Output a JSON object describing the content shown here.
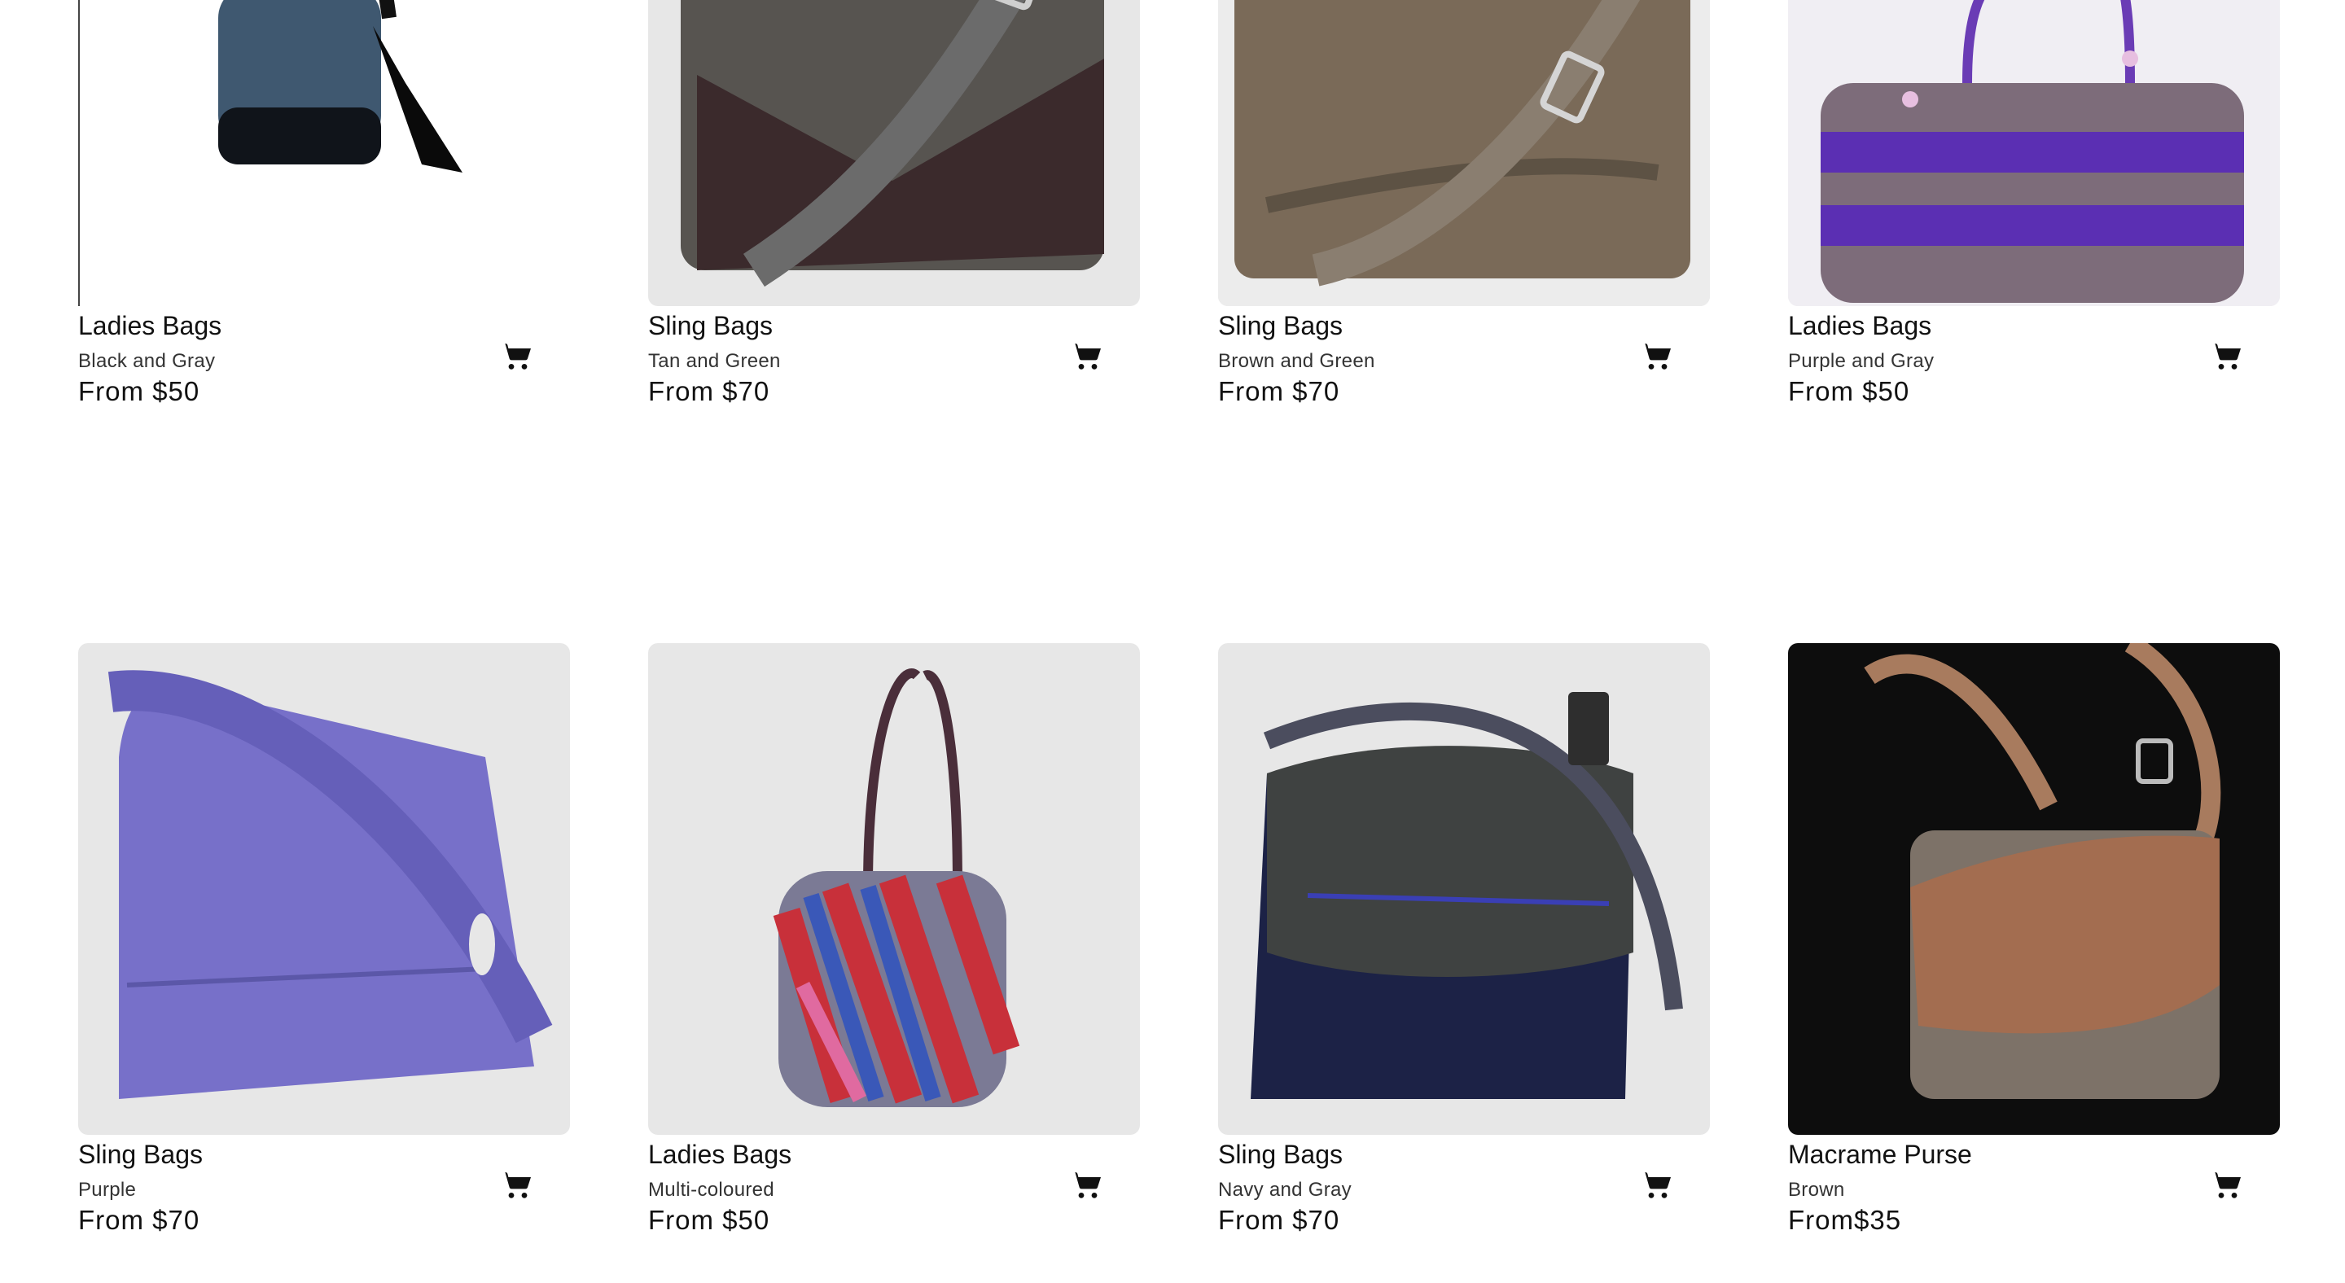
{
  "products": [
    {
      "title": "Ladies Bags",
      "variant": "Black and Gray",
      "price": "From $50",
      "image": "black-gray-bucket-bag"
    },
    {
      "title": "Sling Bags",
      "variant": "Tan and Green",
      "price": "From $70",
      "image": "tan-green-sling-bag"
    },
    {
      "title": "Sling Bags",
      "variant": "Brown and Green",
      "price": "From $70",
      "image": "brown-green-sling-bag"
    },
    {
      "title": "Ladies Bags",
      "variant": "Purple and Gray",
      "price": "From $50",
      "image": "purple-gray-tote-bag"
    },
    {
      "title": "Sling Bags",
      "variant": "Purple",
      "price": "From $70",
      "image": "purple-sling-bag"
    },
    {
      "title": "Ladies Bags",
      "variant": "Multi-coloured",
      "price": "From $50",
      "image": "multicolour-tote-bag"
    },
    {
      "title": "Sling Bags",
      "variant": "Navy and Gray",
      "price": "From $70",
      "image": "navy-gray-sling-bag"
    },
    {
      "title": "Macrame Purse",
      "variant": "Brown",
      "price": "From$35",
      "image": "brown-macrame-purse"
    }
  ],
  "icons": {
    "cart": "shopping-cart-icon"
  }
}
